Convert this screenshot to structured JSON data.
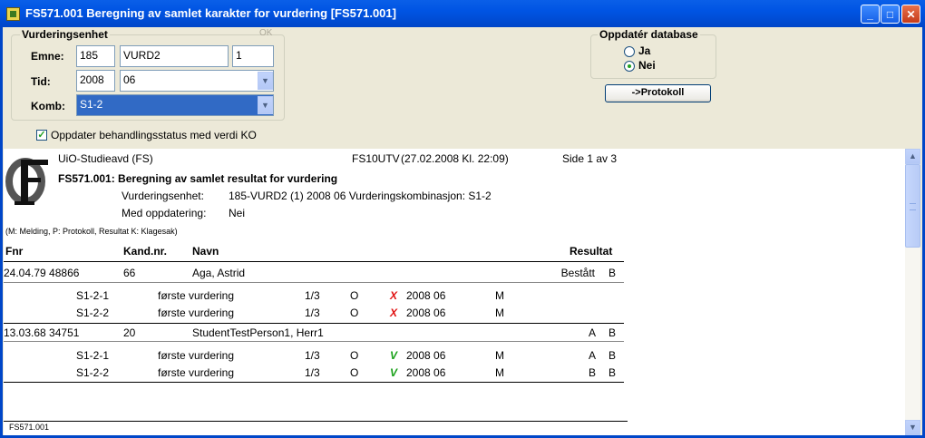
{
  "window": {
    "title": "FS571.001 Beregning av samlet karakter for vurdering [FS571.001]",
    "minimize": "_",
    "maximize": "□",
    "close": "✕"
  },
  "form": {
    "vurderingsenhet_label": "Vurderingsenhet",
    "ok_label": "OK",
    "emne_label": "Emne:",
    "emne_code": "185",
    "emne_name": "VURD2",
    "emne_version": "1",
    "tid_label": "Tid:",
    "tid_year": "2008",
    "tid_term": "06",
    "komb_label": "Komb:",
    "komb_value": "S1-2",
    "oppdater_db_label": "Oppdatér database",
    "radio_ja": "Ja",
    "radio_nei": "Nei",
    "radio_selected": "Nei",
    "protokoll_button": "->Protokoll",
    "checkbox_label": "Oppdater behandlingsstatus med verdi KO",
    "checkbox_checked": true
  },
  "report": {
    "org": "UiO-Studieavd (FS)",
    "report_code": "FS10UTV",
    "timestamp": "(27.02.2008 Kl. 22:09)",
    "page": "Side 1 av 3",
    "title": "FS571.001: Beregning av samlet resultat for vurdering",
    "vurderingsenhet_label": "Vurderingsenhet:",
    "vurderingsenhet_value": "185-VURD2 (1) 2008 06 Vurderingskombinasjon: S1-2",
    "med_oppdatering_label": "Med oppdatering:",
    "med_oppdatering_value": "Nei",
    "legend": "(M: Melding, P: Protokoll, Resultat K: Klagesak)",
    "columns": {
      "fnr": "Fnr",
      "kandnr": "Kand.nr.",
      "navn": "Navn",
      "resultat": "Resultat"
    },
    "students": [
      {
        "fnr": "24.04.79 48866",
        "kandnr": "66",
        "navn": "Aga, Astrid",
        "resultat": "Bestått",
        "flag": "B",
        "rows": [
          {
            "code": "S1-2-1",
            "desc": "første vurdering",
            "frac": "1/3",
            "o": "O",
            "mark": "X",
            "mark_color": "#E01010",
            "term": "2008 06",
            "m": "M",
            "res": "",
            "flag": ""
          },
          {
            "code": "S1-2-2",
            "desc": "første vurdering",
            "frac": "1/3",
            "o": "O",
            "mark": "X",
            "mark_color": "#E01010",
            "term": "2008 06",
            "m": "M",
            "res": "",
            "flag": ""
          }
        ]
      },
      {
        "fnr": "13.03.68 34751",
        "kandnr": "20",
        "navn": "StudentTestPerson1, Herr1",
        "resultat": "A",
        "flag": "B",
        "rows": [
          {
            "code": "S1-2-1",
            "desc": "første vurdering",
            "frac": "1/3",
            "o": "O",
            "mark": "V",
            "mark_color": "#18A018",
            "term": "2008 06",
            "m": "M",
            "res": "A",
            "flag": "B"
          },
          {
            "code": "S1-2-2",
            "desc": "første vurdering",
            "frac": "1/3",
            "o": "O",
            "mark": "V",
            "mark_color": "#18A018",
            "term": "2008 06",
            "m": "M",
            "res": "B",
            "flag": "B"
          }
        ]
      }
    ],
    "footer": "FS571.001"
  }
}
